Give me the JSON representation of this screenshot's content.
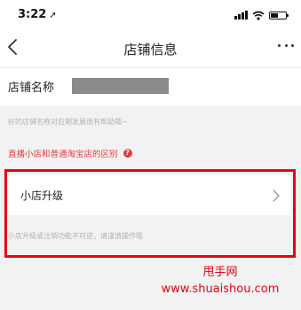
{
  "status_bar": {
    "time": "3:22",
    "location_arrow": "➚",
    "battery_level": 0.5
  },
  "nav": {
    "title": "店铺信息",
    "back_icon": "chevron-left-icon",
    "more_icon": "more-icon"
  },
  "store_name": {
    "label": "店铺名称",
    "value_redacted": true
  },
  "hint": "好的店铺名称对后期发展很有帮助哦~",
  "diff_link": {
    "text": "直播小店和普通淘宝店的区别",
    "help_glyph": "?"
  },
  "upgrade": {
    "label": "小店升级"
  },
  "warning": "小店升级或注销功能不可逆，请谨慎操作哦",
  "watermark": {
    "name": "甩手网",
    "url": "www.shuaishou.com"
  },
  "colors": {
    "accent_red": "#e23c3c",
    "highlight_red": "#e60012",
    "background": "#f2f2f2"
  }
}
